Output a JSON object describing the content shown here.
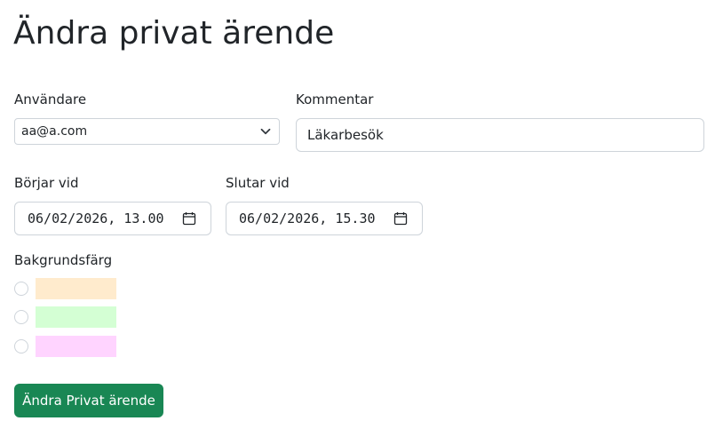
{
  "page": {
    "title": "Ändra privat ärende"
  },
  "form": {
    "user": {
      "label": "Användare",
      "selected": "aa@a.com"
    },
    "comment": {
      "label": "Kommentar",
      "value": "Läkarbesök"
    },
    "start": {
      "label": "Börjar vid",
      "value": "06/02/2026, 13.00"
    },
    "end": {
      "label": "Slutar vid",
      "value": "06/02/2026, 15.30"
    },
    "background": {
      "label": "Bakgrundsfärg",
      "options": [
        {
          "color": "#FFEBCD",
          "checked": false
        },
        {
          "color": "#D4FFD4",
          "checked": false
        },
        {
          "color": "#FFD4FF",
          "checked": false
        }
      ]
    },
    "submit_label": "Ändra Privat ärende"
  },
  "colors": {
    "submit_bg": "#198754",
    "border": "#ced4da",
    "text": "#212529"
  },
  "icons": {
    "select": "chevron-down-icon",
    "date": "calendar-icon"
  }
}
